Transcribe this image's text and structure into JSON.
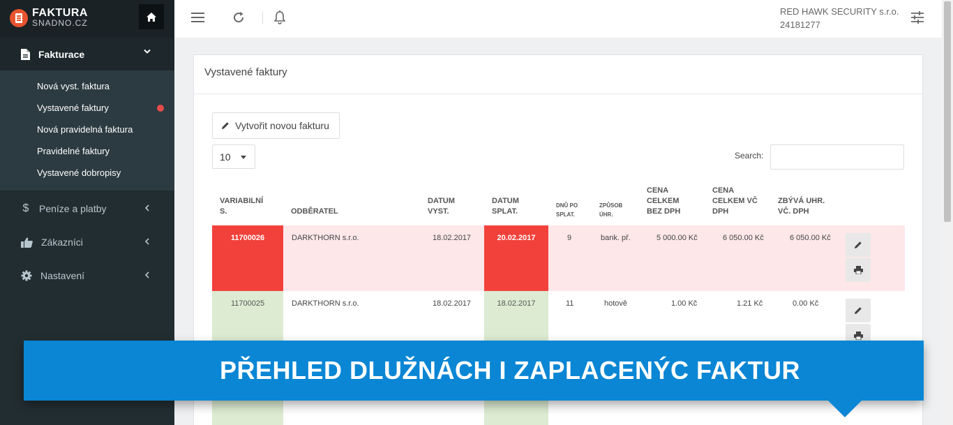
{
  "logo": {
    "line1": "FAKTURA",
    "line2": "SNADNO.CZ"
  },
  "sidebar": {
    "active_section": "Fakturace",
    "subitems": [
      {
        "label": "Nová vyst. faktura"
      },
      {
        "label": "Vystavené faktury"
      },
      {
        "label": "Nová pravidelná faktura"
      },
      {
        "label": "Pravidelné faktury"
      },
      {
        "label": "Vystavené dobropisy"
      }
    ],
    "items": [
      {
        "label": "Peníze a platby",
        "icon": "dollar-icon"
      },
      {
        "label": "Zákazníci",
        "icon": "thumbs-up-icon"
      },
      {
        "label": "Nastavení",
        "icon": "gear-icon"
      }
    ]
  },
  "header": {
    "company_name": "RED HAWK SECURITY s.r.o.",
    "company_id": "24181277"
  },
  "main": {
    "title": "Vystavené faktury",
    "new_button": "Vytvořit novou fakturu",
    "page_length": "10",
    "search_label": "Search:",
    "search_value": ""
  },
  "table": {
    "headers": {
      "variable": [
        "VARIABILNÍ",
        "S."
      ],
      "customer": "ODBĚRATEL",
      "issue": [
        "DATUM",
        "VYST."
      ],
      "due": [
        "DATUM",
        "SPLAT."
      ],
      "days": [
        "DNŮ PO",
        "SPLAT."
      ],
      "method": [
        "ZPŮSOB",
        "ÚHR."
      ],
      "price_net": [
        "CENA",
        "CELKEM",
        "BEZ DPH"
      ],
      "price_gross": [
        "CENA",
        "CELKEM VČ",
        "DPH"
      ],
      "remaining": [
        "ZBÝVÁ UHR.",
        "VČ. DPH"
      ]
    },
    "rows": [
      {
        "variable": "11700026",
        "customer": "DARKTHORN s.r.o.",
        "issue": "18.02.2017",
        "due": "20.02.2017",
        "days": "9",
        "method": "bank. př.",
        "net": "5 000.00 Kč",
        "gross": "6 050.00 Kč",
        "remaining": "6 050.00 Kč",
        "status": "overdue"
      },
      {
        "variable": "11700025",
        "customer": "DARKTHORN s.r.o.",
        "issue": "18.02.2017",
        "due": "18.02.2017",
        "days": "11",
        "method": "hotově",
        "net": "1.00 Kč",
        "gross": "1.21 Kč",
        "remaining": "0.00 Kč",
        "status": "paid"
      }
    ]
  },
  "banner": {
    "text": "PŘEHLED DLUŽNÁCH I ZAPLACENÝC FAKTUR"
  },
  "colors": {
    "overdue": "#f2413b",
    "overdue_row": "#fde7e9",
    "paid": "#dcebd2",
    "banner": "#0a86d4",
    "sidebar": "#222d32"
  }
}
